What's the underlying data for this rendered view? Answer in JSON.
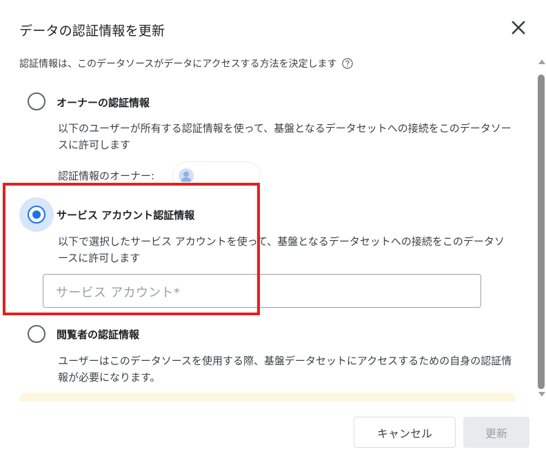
{
  "dialog": {
    "title": "データの認証情報を更新",
    "description": "認証情報は、このデータソースがデータにアクセスする方法を決定します"
  },
  "options": [
    {
      "label": "オーナーの認証情報",
      "description": "以下のユーザーが所有する認証情報を使って、基盤となるデータセットへの接続をこのデータソースに許可します",
      "selected": false,
      "owner_label": "認証情報のオーナー:"
    },
    {
      "label": "サービス アカウント認証情報",
      "description": "以下で選択したサービス アカウントを使って、基盤となるデータセットへの接続をこのデータソースに許可します",
      "selected": true,
      "input_placeholder": "サービス アカウント*"
    },
    {
      "label": "閲覧者の認証情報",
      "description": "ユーザーはこのデータソースを使用する際、基盤データセットにアクセスするための自身の認証情報が必要になります。",
      "selected": false
    }
  ],
  "footer": {
    "cancel_label": "キャンセル",
    "update_label": "更新"
  },
  "colors": {
    "accent": "#1a73e8",
    "highlight": "#e02020",
    "selected_bg": "#d7e6fb",
    "banner_bg": "#fef7e0"
  },
  "icons": {
    "close": "close-icon",
    "help": "help-circle-icon",
    "avatar": "user-avatar-icon"
  }
}
